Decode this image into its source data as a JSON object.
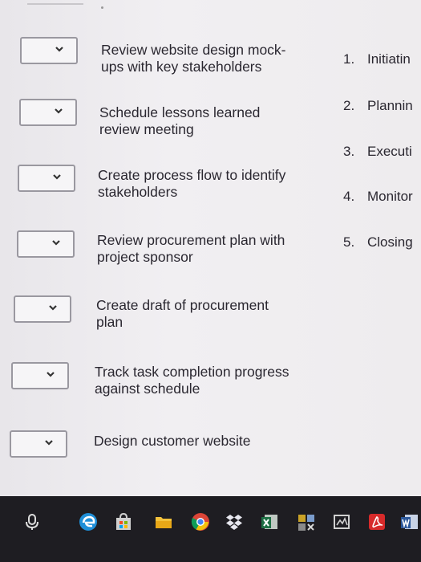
{
  "rows": [
    {
      "task": "Review website design mock-ups with key stakeholders",
      "task_lines": [
        "Review website design mock-",
        "ups with key stakeholders"
      ]
    },
    {
      "task": "Schedule lessons learned review meeting",
      "task_lines": [
        "Schedule lessons learned",
        "review meeting"
      ]
    },
    {
      "task": "Create process flow to identify stakeholders",
      "task_lines": [
        "Create process flow to identify",
        "stakeholders"
      ]
    },
    {
      "task": "Review procurement plan with project sponsor",
      "task_lines": [
        "Review procurement plan with",
        "project sponsor"
      ]
    },
    {
      "task": "Create draft of procurement plan",
      "task_lines": [
        "Create draft of procurement",
        "plan"
      ]
    },
    {
      "task": "Track task completion progress against schedule",
      "task_lines": [
        "Track task completion progress",
        "against schedule"
      ]
    },
    {
      "task": "Design customer website",
      "task_lines": [
        "Design customer website",
        ""
      ]
    }
  ],
  "options": [
    {
      "num": "1.",
      "label": "Initiatin"
    },
    {
      "num": "2.",
      "label": "Plannin"
    },
    {
      "num": "3.",
      "label": "Executi"
    },
    {
      "num": "4.",
      "label": "Monitor"
    },
    {
      "num": "5.",
      "label": "Closing"
    }
  ],
  "taskbar_icons": [
    "microphone-icon",
    "edge-browser-icon",
    "store-icon",
    "file-explorer-icon",
    "chrome-icon",
    "dropbox-icon",
    "excel-icon",
    "tools-icon",
    "app-icon",
    "acrobat-icon",
    "word-icon"
  ],
  "colors": {
    "text": "#2a2730",
    "taskbar": "#1e1d22",
    "dropdown_border": "#9a98a0"
  }
}
